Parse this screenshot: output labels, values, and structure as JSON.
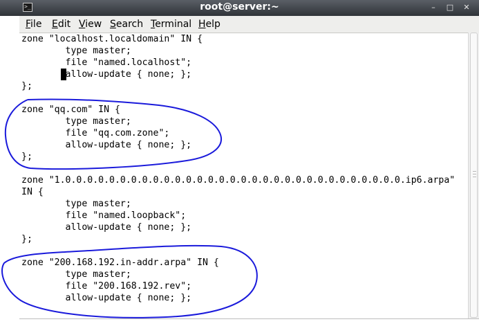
{
  "window": {
    "title": "root@server:~",
    "icon": "terminal-icon",
    "controls": {
      "minimize": "–",
      "maximize": "□",
      "close": "✕"
    }
  },
  "menu": {
    "file": {
      "accel": "F",
      "rest": "ile"
    },
    "edit": {
      "accel": "E",
      "rest": "dit"
    },
    "view": {
      "accel": "V",
      "rest": "iew"
    },
    "search": {
      "accel": "S",
      "rest": "earch"
    },
    "terminal": {
      "accel": "T",
      "rest": "erminal"
    },
    "help": {
      "accel": "H",
      "rest": "elp"
    }
  },
  "terminal": {
    "lines": [
      "zone \"localhost.localdomain\" IN {",
      "        type master;",
      "        file \"named.localhost\";",
      "        allow-update { none; };",
      "};",
      "",
      "zone \"qq.com\" IN {",
      "        type master;",
      "        file \"qq.com.zone\";",
      "        allow-update { none; };",
      "};",
      "",
      "zone \"1.0.0.0.0.0.0.0.0.0.0.0.0.0.0.0.0.0.0.0.0.0.0.0.0.0.0.0.0.0.0.0.ip6.arpa\"",
      "IN {",
      "        type master;",
      "        file \"named.loopback\";",
      "        allow-update { none; };",
      "};",
      "",
      "zone \"200.168.192.in-addr.arpa\" IN {",
      "        type master;",
      "        file \"200.168.192.rev\";",
      "        allow-update { none; };",
      ""
    ]
  },
  "colors": {
    "annotation": "#1a1adb",
    "titlebar": "#3b3f45",
    "menubar": "#eeeeec"
  }
}
